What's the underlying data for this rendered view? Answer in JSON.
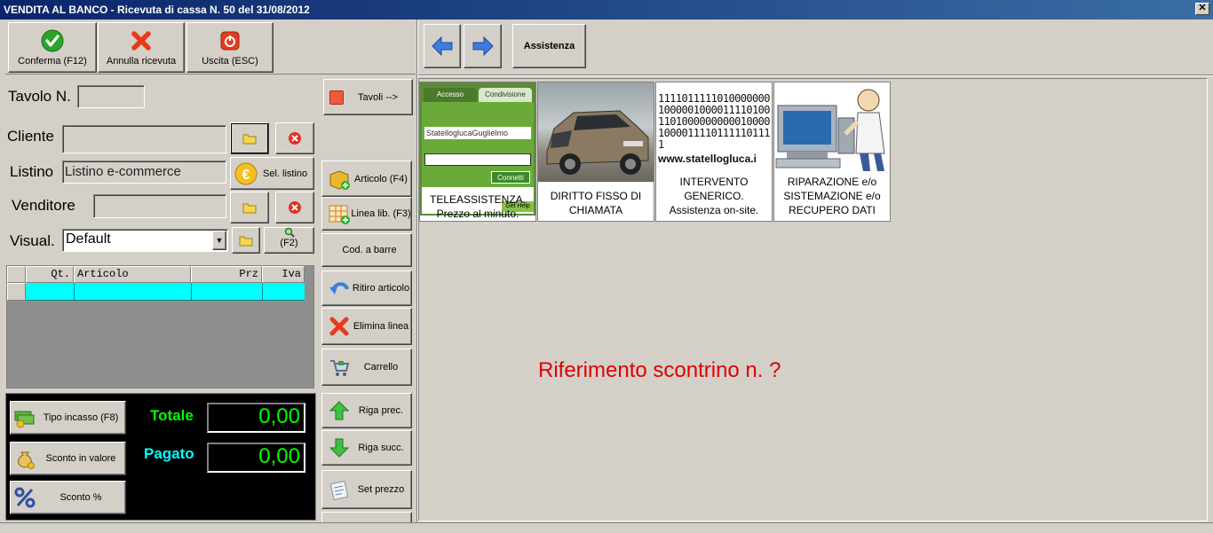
{
  "window": {
    "title": "VENDITA AL BANCO - Ricevuta di cassa N. 50 del 31/08/2012",
    "title_prefix": "VE",
    "close_glyph": "✕"
  },
  "toolbar": {
    "confirm_label": "Conferma (F12)",
    "cancel_label": "Annulla ricevuta",
    "exit_label": "Uscita (ESC)",
    "assist_label": "Assistenza"
  },
  "form": {
    "table_label": "Tavolo N.",
    "table_value": "",
    "tables_button": "Tavoli -->",
    "customer_label": "Cliente",
    "customer_value": "",
    "pricelist_label": "Listino",
    "pricelist_value": "Listino e-commerce",
    "pricelist_button": "Sel. listino",
    "seller_label": "Venditore",
    "seller_value": "",
    "view_label": "Visual.",
    "view_value": "Default",
    "search_f2": "(F2)"
  },
  "grid": {
    "columns": [
      "Qt.",
      "Articolo",
      "Prz",
      "Iva"
    ]
  },
  "side_buttons": [
    {
      "label": "Articolo (F4)"
    },
    {
      "label": "Linea lib. (F3)"
    },
    {
      "label": "Cod. a barre"
    },
    {
      "label": "Ritiro articolo"
    },
    {
      "label": "Elimina linea"
    },
    {
      "label": "Carrello"
    },
    {
      "label": "Riga prec."
    },
    {
      "label": "Riga succ."
    },
    {
      "label": "Set prezzo"
    }
  ],
  "payment": {
    "type_label": "Tipo incasso (F8)",
    "discount_value_label": "Sconto in valore",
    "discount_pct_label": "Sconto %",
    "total_label": "Totale",
    "total_value": "0,00",
    "paid_label": "Pagato",
    "paid_value": "0,00"
  },
  "tiles": [
    {
      "caption": "TELEASSISTENZA. Prezzo al minuto.",
      "tab1": "Accesso",
      "tab2": "Condivisione",
      "name_text": "StatelloglucaGuglielmo",
      "connect": "Connetti",
      "help": "Get Help"
    },
    {
      "caption": "DIRITTO FISSO DI CHIAMATA"
    },
    {
      "caption": "INTERVENTO GENERICO. Assistenza on-site.",
      "binary": "11110111110100000001000001000011110100110100000000001000010000111101111101111",
      "site": "www.statellogluca.i"
    },
    {
      "caption": "RIPARAZIONE e/o SISTEMAZIONE e/o RECUPERO DATI"
    }
  ],
  "message": "Riferimento scontrino n. ?",
  "colors": {
    "titlebar": "#0a246a",
    "grid_row": "#00ffff",
    "lcd_text": "#00ff00",
    "total_label": "#00ff00",
    "paid_label": "#00ffff",
    "message": "#e00000",
    "face": "#d4d0c8"
  }
}
